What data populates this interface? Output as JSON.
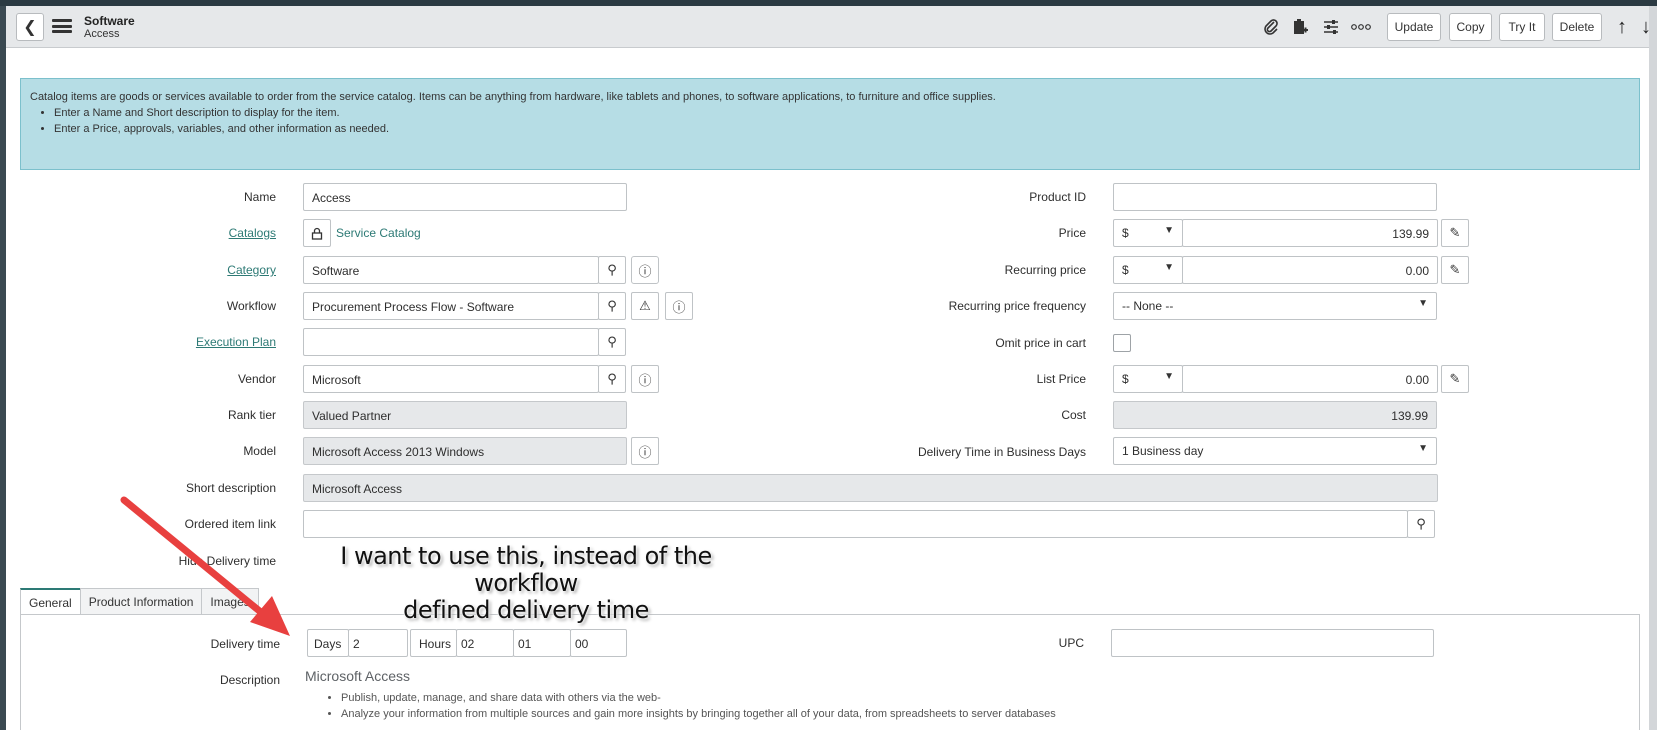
{
  "header": {
    "title": "Software",
    "subtitle": "Access",
    "buttons": {
      "update": "Update",
      "copy": "Copy",
      "try_it": "Try It",
      "delete": "Delete"
    }
  },
  "info": {
    "text": "Catalog items are goods or services available to order from the service catalog. Items can be anything from hardware, like tablets and phones, to software applications, to furniture and office supplies.",
    "bullets": [
      "Enter a Name and Short description to display for the item.",
      "Enter a Price, approvals, variables, and other information as needed."
    ]
  },
  "form": {
    "name_label": "Name",
    "name_value": "Access",
    "catalogs_label": "Catalogs",
    "catalogs_value": "Service Catalog",
    "category_label": "Category",
    "category_value": "Software",
    "workflow_label": "Workflow",
    "workflow_value": "Procurement Process Flow - Software",
    "execution_plan_label": "Execution Plan",
    "execution_plan_value": "",
    "vendor_label": "Vendor",
    "vendor_value": "Microsoft",
    "rank_tier_label": "Rank tier",
    "rank_tier_value": "Valued Partner",
    "model_label": "Model",
    "model_value": "Microsoft Access 2013 Windows",
    "short_desc_label": "Short description",
    "short_desc_value": "Microsoft Access",
    "ordered_item_link_label": "Ordered item link",
    "ordered_item_link_value": "",
    "hide_delivery_label": "Hide Delivery time",
    "product_id_label": "Product ID",
    "product_id_value": "",
    "price_label": "Price",
    "price_currency": "$",
    "price_value": "139.99",
    "recurring_price_label": "Recurring price",
    "recurring_currency": "$",
    "recurring_value": "0.00",
    "recurring_freq_label": "Recurring price frequency",
    "recurring_freq_value": "-- None --",
    "omit_price_label": "Omit price in cart",
    "list_price_label": "List Price",
    "list_currency": "$",
    "list_value": "0.00",
    "cost_label": "Cost",
    "cost_value": "139.99",
    "delivery_days_label": "Delivery Time in Business Days",
    "delivery_days_value": "1 Business day"
  },
  "tabs": [
    "General",
    "Product Information",
    "Images"
  ],
  "general": {
    "delivery_time_label": "Delivery time",
    "days_label": "Days",
    "days_value": "2",
    "hours_label": "Hours",
    "hours_value": "02",
    "minutes_value": "01",
    "seconds_value": "00",
    "upc_label": "UPC",
    "upc_value": "",
    "description_label": "Description",
    "description_title": "Microsoft Access",
    "description_bullets": [
      "Publish, update, manage, and share data with others via the web-",
      "Analyze your information from multiple sources and gain more insights by bringing together all of your data, from spreadsheets to server databases"
    ]
  },
  "annotation": {
    "line1": "I want to use this, instead of the workflow",
    "line2": "defined delivery time"
  },
  "colors": {
    "info_bg": "#b6dde5",
    "link": "#2d7a75",
    "arrow": "#e8403f"
  }
}
